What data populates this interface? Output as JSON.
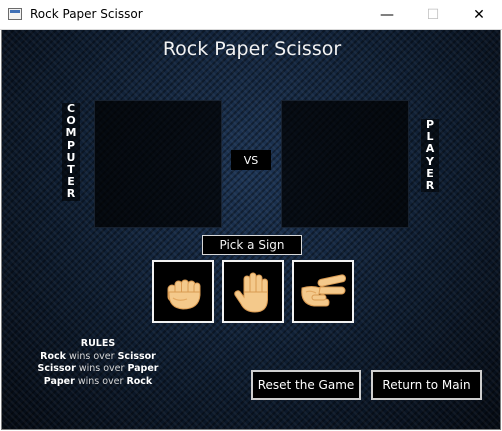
{
  "window": {
    "title": "Rock Paper Scissor",
    "minimize": "—",
    "maximize": "☐",
    "close": "✕"
  },
  "game": {
    "title": "Rock Paper Scissor",
    "computer_label": "COMPUTER",
    "player_label": "PLAYER",
    "vs_label": "VS",
    "pick_label": "Pick a Sign"
  },
  "signs": [
    {
      "name": "rock",
      "icon": "rock-fist-icon"
    },
    {
      "name": "paper",
      "icon": "paper-hand-icon"
    },
    {
      "name": "scissor",
      "icon": "scissor-hand-icon"
    }
  ],
  "rules": {
    "heading": "RULES",
    "lines": [
      {
        "winner": "Rock",
        "text": "wins over",
        "loser": "Scissor"
      },
      {
        "winner": "Scissor",
        "text": "wins over",
        "loser": "Paper"
      },
      {
        "winner": "Paper",
        "text": "wins over",
        "loser": "Rock"
      }
    ]
  },
  "buttons": {
    "reset": "Reset the Game",
    "main": "Return to Main"
  },
  "colors": {
    "background": "#0b1726",
    "panel": "#000000",
    "skin": "#f4c98b",
    "skin_shadow": "#e3a861",
    "text": "#ffffff"
  }
}
